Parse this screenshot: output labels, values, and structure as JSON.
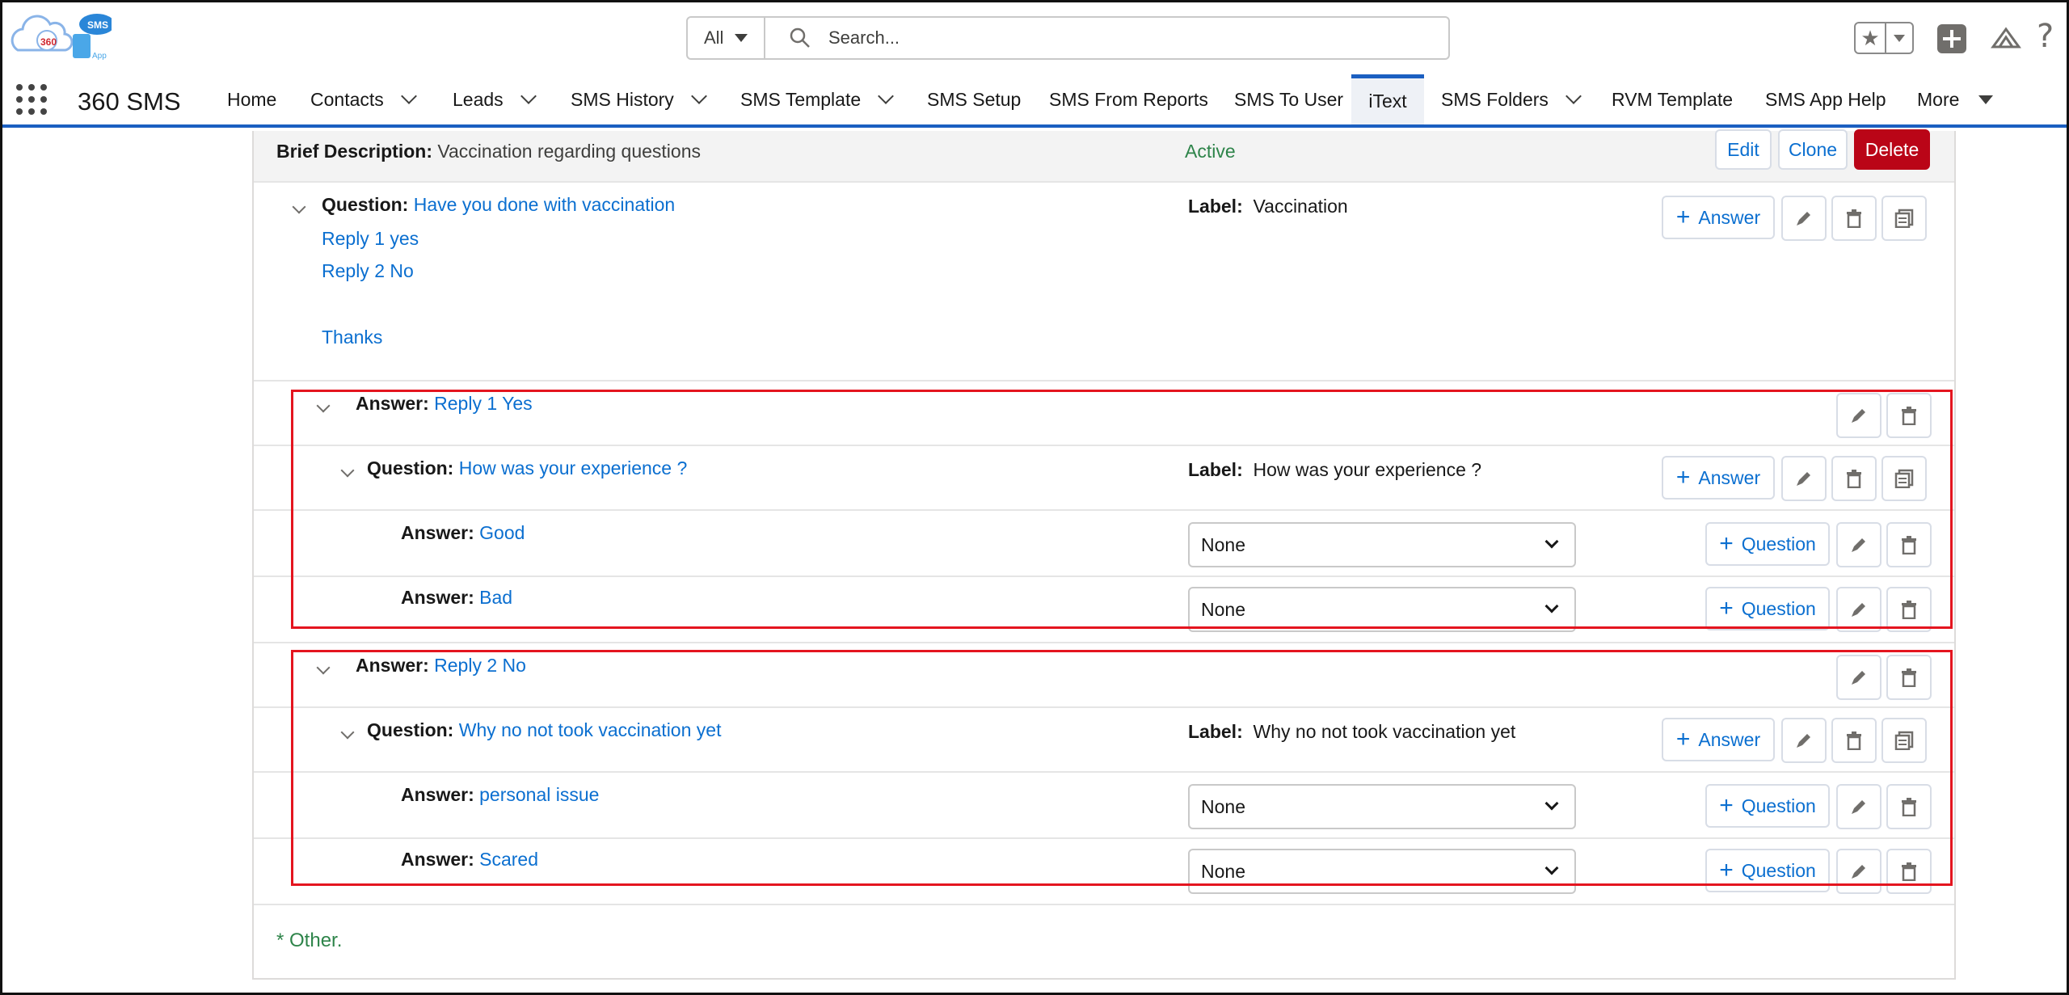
{
  "header": {
    "logo_text": "360",
    "logo_badge": "SMS",
    "logo_sub": "App",
    "search_scope": "All",
    "search_placeholder": "Search..."
  },
  "nav": {
    "app_name": "360 SMS",
    "items": [
      {
        "label": "Home",
        "has_menu": false
      },
      {
        "label": "Contacts",
        "has_menu": true
      },
      {
        "label": "Leads",
        "has_menu": true
      },
      {
        "label": "SMS History",
        "has_menu": true
      },
      {
        "label": "SMS Template",
        "has_menu": true
      },
      {
        "label": "SMS Setup",
        "has_menu": false
      },
      {
        "label": "SMS From Reports",
        "has_menu": false
      },
      {
        "label": "SMS To User",
        "has_menu": false
      },
      {
        "label": "iText",
        "has_menu": false,
        "active": true
      },
      {
        "label": "SMS Folders",
        "has_menu": true
      },
      {
        "label": "RVM Template",
        "has_menu": false
      },
      {
        "label": "SMS App Help",
        "has_menu": false
      },
      {
        "label": "More",
        "has_menu": true
      }
    ]
  },
  "description": {
    "label": "Brief Description:",
    "value": "Vaccination regarding questions",
    "status": "Active",
    "edit": "Edit",
    "clone": "Clone",
    "delete": "Delete"
  },
  "root_question": {
    "prefix": "Question:",
    "text": "Have you done with vaccination",
    "lines": [
      "Reply 1 yes",
      "Reply 2 No",
      "Thanks"
    ],
    "label_prefix": "Label:",
    "label": "Vaccination",
    "answer_btn": "Answer"
  },
  "branches": [
    {
      "answer_prefix": "Answer:",
      "answer": "Reply 1 Yes",
      "question_prefix": "Question:",
      "question": "How was your experience ?",
      "label_prefix": "Label:",
      "label": "How was your experience ?",
      "answer_btn": "Answer",
      "answers": [
        {
          "prefix": "Answer:",
          "text": "Good",
          "select": "None",
          "btn": "Question"
        },
        {
          "prefix": "Answer:",
          "text": "Bad",
          "select": "None",
          "btn": "Question"
        }
      ]
    },
    {
      "answer_prefix": "Answer:",
      "answer": "Reply 2 No",
      "question_prefix": "Question:",
      "question": "Why no not took vaccination yet",
      "label_prefix": "Label:",
      "label": "Why no not took vaccination yet",
      "answer_btn": "Answer",
      "answers": [
        {
          "prefix": "Answer:",
          "text": "personal issue",
          "select": "None",
          "btn": "Question"
        },
        {
          "prefix": "Answer:",
          "text": "Scared",
          "select": "None",
          "btn": "Question"
        }
      ]
    }
  ],
  "footer_note": "* Other.",
  "colors": {
    "brand": "#1b5fc1",
    "link": "#0b6fd0",
    "active": "#2e844a",
    "danger": "#ba0517",
    "highlight": "#e4151f"
  }
}
